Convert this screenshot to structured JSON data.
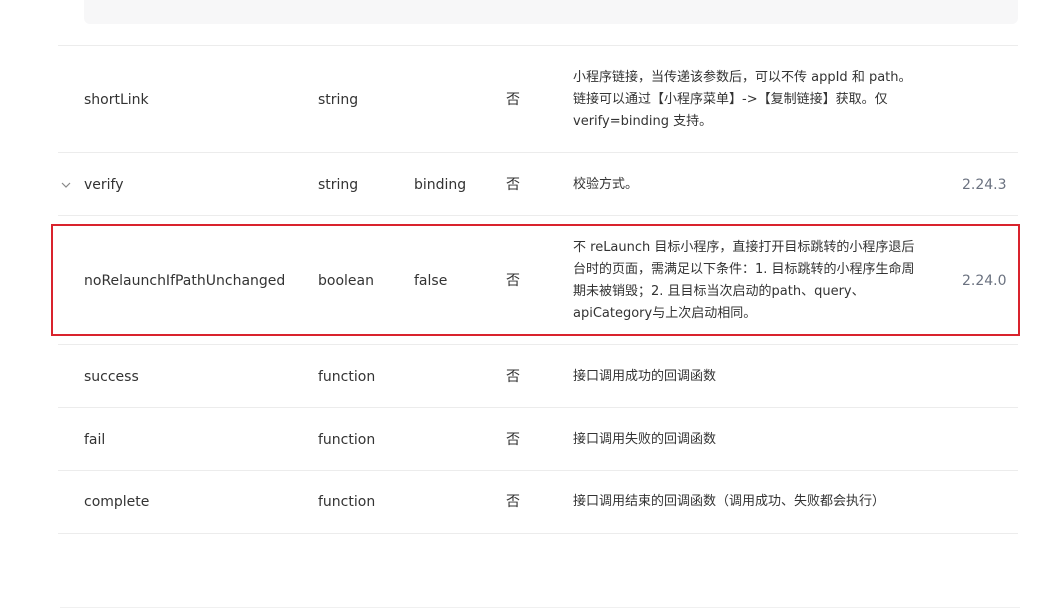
{
  "rows": [
    {
      "name": "shortLink",
      "type": "string",
      "default": "",
      "required": "否",
      "description": "小程序链接，当传递该参数后，可以不传 appId 和 path。链接可以通过【小程序菜单】->【复制链接】获取。仅 verify=binding 支持。",
      "version": ""
    },
    {
      "name": "verify",
      "type": "string",
      "default": "binding",
      "required": "否",
      "description": "校验方式。",
      "version": "2.24.3"
    },
    {
      "name": "noRelaunchIfPathUnchanged",
      "type": "boolean",
      "default": "false",
      "required": "否",
      "description": "不 reLaunch 目标小程序，直接打开目标跳转的小程序退后台时的页面，需满足以下条件：1. 目标跳转的小程序生命周期未被销毁；2. 且目标当次启动的path、query、apiCategory与上次启动相同。",
      "version": "2.24.0"
    },
    {
      "name": "success",
      "type": "function",
      "default": "",
      "required": "否",
      "description": "接口调用成功的回调函数",
      "version": ""
    },
    {
      "name": "fail",
      "type": "function",
      "default": "",
      "required": "否",
      "description": "接口调用失败的回调函数",
      "version": ""
    },
    {
      "name": "complete",
      "type": "function",
      "default": "",
      "required": "否",
      "description": "接口调用结束的回调函数（调用成功、失败都会执行）",
      "version": ""
    }
  ],
  "colors": {
    "highlight_border": "#d9232d",
    "row_divider": "#ececec",
    "version_text": "#6b7280"
  },
  "icons": {
    "verify_row": "chevron-down-icon"
  }
}
